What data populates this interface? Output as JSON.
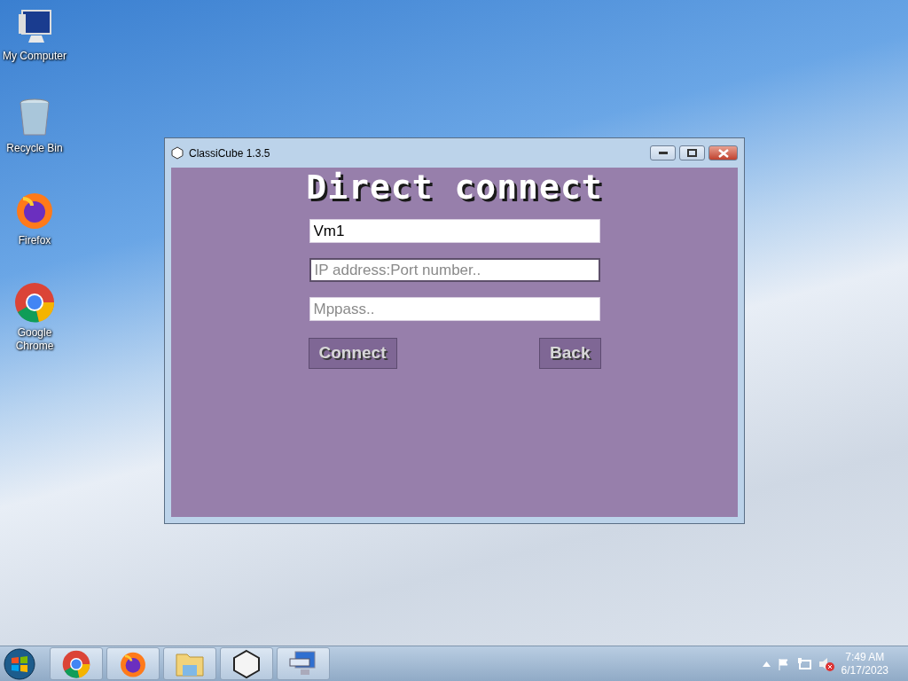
{
  "desktop_icons": [
    {
      "label": "My Computer",
      "kind": "computer"
    },
    {
      "label": "Recycle Bin",
      "kind": "bin"
    },
    {
      "label": "Firefox",
      "kind": "firefox"
    },
    {
      "label": "Google Chrome",
      "kind": "chrome"
    }
  ],
  "window": {
    "title": "ClassiCube 1.3.5",
    "heading": "Direct connect",
    "fields": [
      {
        "value": "Vm1",
        "focused": false
      },
      {
        "placeholder": "IP address:Port number..",
        "focused": true
      },
      {
        "placeholder": "Mppass..",
        "focused": false
      }
    ],
    "buttons": [
      "Connect",
      "Back"
    ]
  },
  "taskbar": {
    "apps": [
      {
        "kind": "chrome"
      },
      {
        "kind": "firefox"
      },
      {
        "kind": "folder"
      },
      {
        "kind": "cube"
      },
      {
        "kind": "keyboard"
      }
    ],
    "time": "7:49 AM",
    "date": "6/17/2023"
  }
}
